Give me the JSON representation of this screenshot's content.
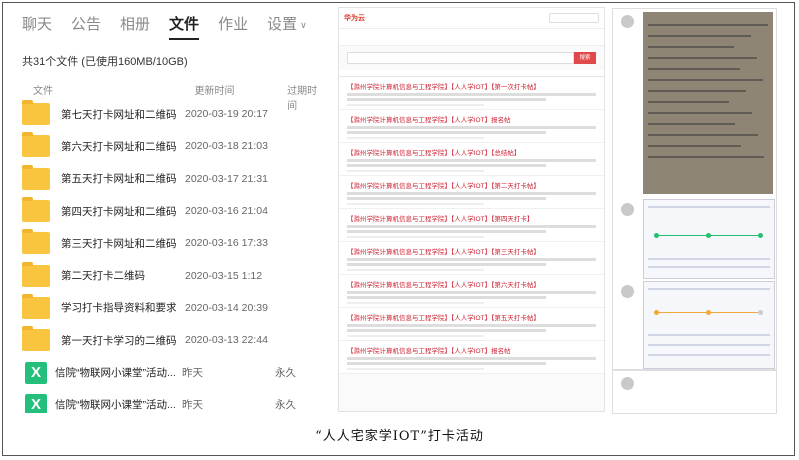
{
  "left_panel": {
    "tabs": [
      {
        "label": "聊天"
      },
      {
        "label": "公告"
      },
      {
        "label": "相册"
      },
      {
        "label": "文件"
      },
      {
        "label": "作业"
      },
      {
        "label": "设置"
      }
    ],
    "active_tab": "文件",
    "summary": "共31个文件 (已使用160MB/10GB)",
    "columns": {
      "name": "文件",
      "updated": "更新时间",
      "expiry": "过期时间"
    },
    "files": [
      {
        "type": "folder",
        "name": "第七天打卡网址和二维码",
        "updated": "2020-03-19 20:17",
        "expiry": ""
      },
      {
        "type": "folder",
        "name": "第六天打卡网址和二维码",
        "updated": "2020-03-18 21:03",
        "expiry": ""
      },
      {
        "type": "folder",
        "name": "第五天打卡网址和二维码",
        "updated": "2020-03-17 21:31",
        "expiry": ""
      },
      {
        "type": "folder",
        "name": "第四天打卡网址和二维码",
        "updated": "2020-03-16 21:04",
        "expiry": ""
      },
      {
        "type": "folder",
        "name": "第三天打卡网址和二维码",
        "updated": "2020-03-16 17:33",
        "expiry": ""
      },
      {
        "type": "folder",
        "name": "第二天打卡二维码",
        "updated": "2020-03-15 1:12",
        "expiry": ""
      },
      {
        "type": "folder",
        "name": "学习打卡指导资料和要求",
        "updated": "2020-03-14 20:39",
        "expiry": ""
      },
      {
        "type": "folder",
        "name": "第一天打卡学习的二维码",
        "updated": "2020-03-13 22:44",
        "expiry": ""
      },
      {
        "type": "xls",
        "name": "信院“物联网小课堂”活动...",
        "updated": "昨天",
        "expiry": "永久"
      },
      {
        "type": "xls",
        "name": "信院“物联网小课堂”活动...",
        "updated": "昨天",
        "expiry": "永久"
      }
    ]
  },
  "middle_panel": {
    "logo": "华为云",
    "search_button": "搜索",
    "post_titles": [
      "【滁州学院计算机信息与工程学院】【人人学IOT】【第一次打卡帖】",
      "【滁州学院计算机信息与工程学院】【人人学IOT】报名帖",
      "【滁州学院计算机信息与工程学院】【人人学IOT】【总结帖】",
      "【滁州学院计算机信息与工程学院】【人人学IOT】【第二天打卡帖】",
      "【滁州学院计算机信息与工程学院】【人人学IOT】【第四天打卡】",
      "【滁州学院计算机信息与工程学院】【人人学IOT】【第三天打卡帖】",
      "【滁州学院计算机信息与工程学院】【人人学IOT】【第六天打卡帖】",
      "【滁州学院计算机信息与工程学院】【人人学IOT】【第五天打卡帖】",
      "【滁州学院计算机信息与工程学院】【人人学IOT】报名帖"
    ]
  },
  "caption": "“人人宅家学IOT”打卡活动"
}
